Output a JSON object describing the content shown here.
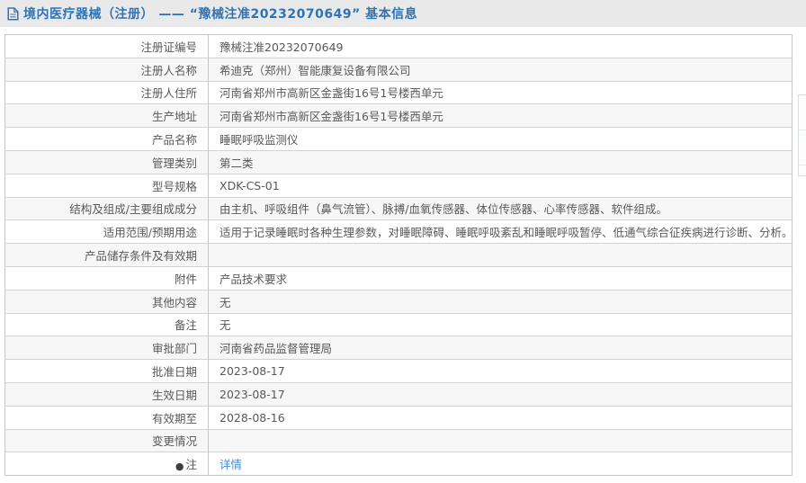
{
  "colors": {
    "accent_blue": "#2e74b5",
    "link_blue": "#3e8ddd",
    "topbar_bg": "#e9e9e9",
    "alt_row_bg": "#f7f7f7",
    "border": "#c6c6c6",
    "text": "#595959"
  },
  "header": {
    "icon": "document-icon",
    "title": "境内医疗器械（注册） —— “豫械注准20232070649” 基本信息"
  },
  "table": {
    "rows": [
      {
        "label": "注册证编号",
        "value": "豫械注准20232070649"
      },
      {
        "label": "注册人名称",
        "value": "希迪克（郑州）智能康复设备有限公司"
      },
      {
        "label": "注册人住所",
        "value": "河南省郑州市高新区金盏街16号1号楼西单元"
      },
      {
        "label": "生产地址",
        "value": "河南省郑州市高新区金盏街16号1号楼西单元"
      },
      {
        "label": "产品名称",
        "value": "睡眠呼吸监测仪"
      },
      {
        "label": "管理类别",
        "value": "第二类"
      },
      {
        "label": "型号规格",
        "value": "XDK-CS-01"
      },
      {
        "label": "结构及组成/主要组成成分",
        "value": "由主机、呼吸组件（鼻气流管）、脉搏/血氧传感器、体位传感器、心率传感器、软件组成。"
      },
      {
        "label": "适用范围/预期用途",
        "value": "适用于记录睡眠时各种生理参数，对睡眠障碍、睡眠呼吸紊乱和睡眠呼吸暂停、低通气综合征疾病进行诊断、分析。"
      },
      {
        "label": "产品储存条件及有效期",
        "value": ""
      },
      {
        "label": "附件",
        "value": "产品技术要求"
      },
      {
        "label": "其他内容",
        "value": "无"
      },
      {
        "label": "备注",
        "value": "无"
      },
      {
        "label": "审批部门",
        "value": "河南省药品监督管理局"
      },
      {
        "label": "批准日期",
        "value": "2023-08-17"
      },
      {
        "label": "生效日期",
        "value": "2023-08-17"
      },
      {
        "label": "有效期至",
        "value": "2028-08-16"
      },
      {
        "label": "变更情况",
        "value": ""
      },
      {
        "label": "注",
        "icon": "note-icon",
        "value": "详情",
        "value_is_link": true
      }
    ]
  }
}
